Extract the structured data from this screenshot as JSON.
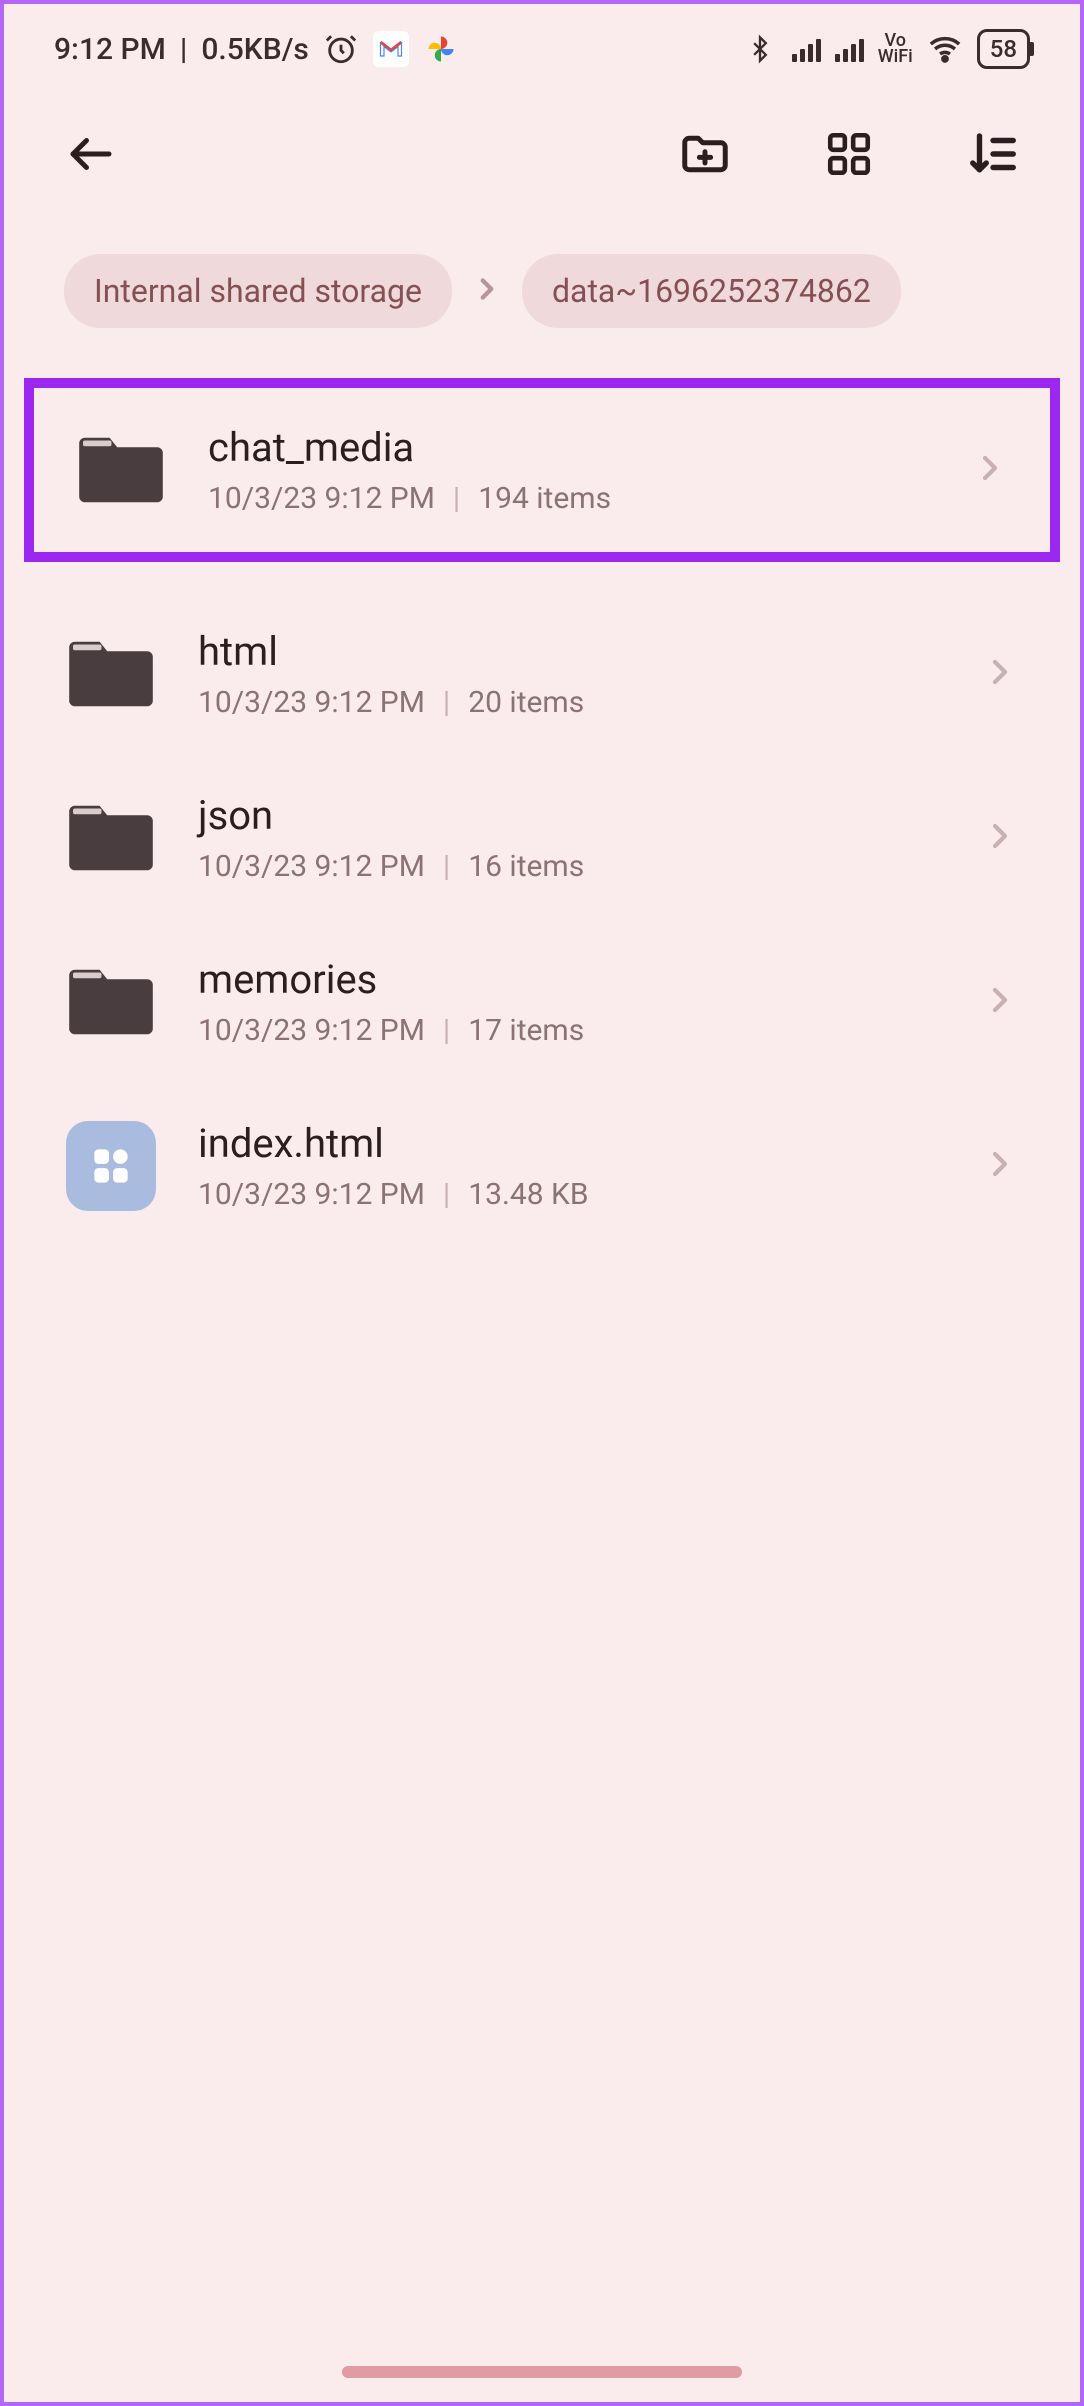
{
  "status": {
    "time": "9:12 PM",
    "net_speed": "0.5KB/s",
    "vo": "Vo",
    "wifi": "WiFi",
    "battery": "58"
  },
  "breadcrumb": {
    "root": "Internal shared storage",
    "current": "data~1696252374862"
  },
  "items": [
    {
      "name": "chat_media",
      "type": "folder",
      "date": "10/3/23 9:12 PM",
      "count": "194 items",
      "highlighted": true
    },
    {
      "name": "html",
      "type": "folder",
      "date": "10/3/23 9:12 PM",
      "count": "20 items",
      "highlighted": false
    },
    {
      "name": "json",
      "type": "folder",
      "date": "10/3/23 9:12 PM",
      "count": "16 items",
      "highlighted": false
    },
    {
      "name": "memories",
      "type": "folder",
      "date": "10/3/23 9:12 PM",
      "count": "17 items",
      "highlighted": false
    },
    {
      "name": "index.html",
      "type": "file",
      "date": "10/3/23 9:12 PM",
      "count": "13.48 KB",
      "highlighted": false
    }
  ]
}
